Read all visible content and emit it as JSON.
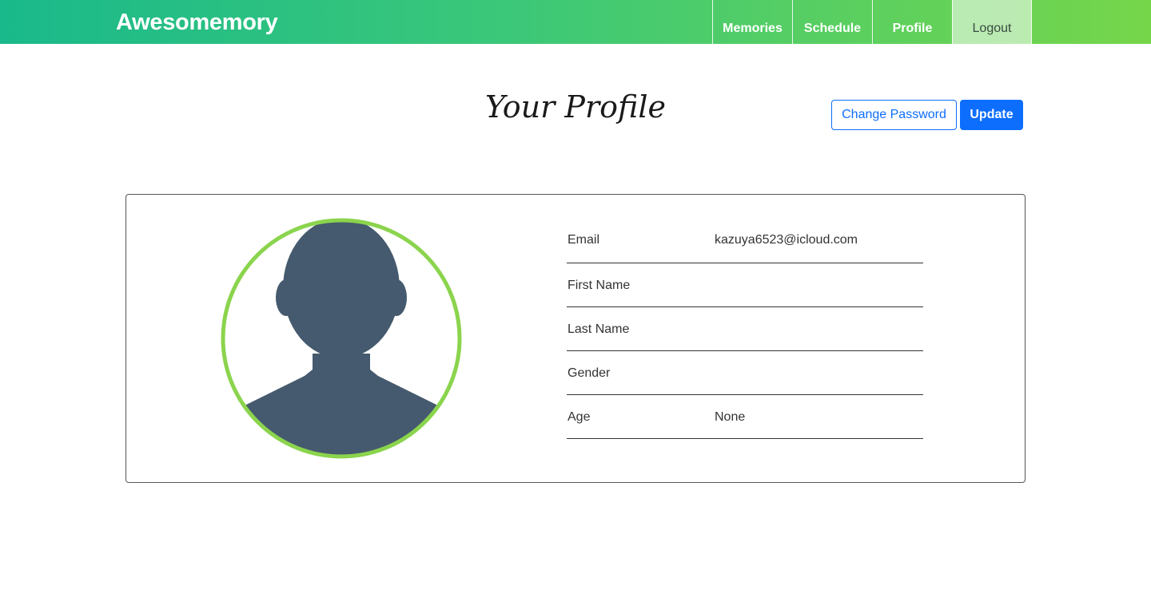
{
  "brand": "Awesomemory",
  "nav": [
    {
      "label": "Memories"
    },
    {
      "label": "Schedule"
    },
    {
      "label": "Profile"
    },
    {
      "label": "Logout"
    }
  ],
  "page": {
    "title": "Your Profile",
    "change_password_label": "Change Password",
    "update_label": "Update"
  },
  "profile": {
    "fields": [
      {
        "label": "Email",
        "value": "kazuya6523@icloud.com"
      },
      {
        "label": "First Name",
        "value": ""
      },
      {
        "label": "Last Name",
        "value": ""
      },
      {
        "label": "Gender",
        "value": ""
      },
      {
        "label": "Age",
        "value": "None"
      }
    ]
  },
  "colors": {
    "avatar_ring": "#8bd44d",
    "avatar_silhouette": "#455a6e",
    "primary": "#0d6efd"
  },
  "icons": {
    "avatar": "user-silhouette-icon"
  }
}
